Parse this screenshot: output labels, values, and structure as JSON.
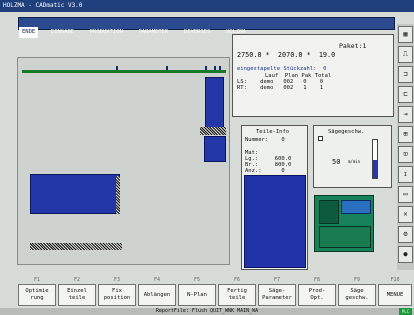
{
  "app": {
    "title": "HOLZMA - CADmatic V3.0"
  },
  "menu": {
    "items": [
      "ENDE",
      "EINGABE",
      "PRODUKTION",
      "PARAMETER",
      "DIVERSES",
      "HOLZMA"
    ]
  },
  "info": {
    "paket_line": "Paket:1",
    "dims_line": "2750.0 *  2070.0 *  19.0",
    "stueckzahl_label": "eingestapelte Stückzahl:  0",
    "header": "Lauf  Plan Pak Total",
    "ls": "LS:    demo   002   0    0",
    "rt": "RT:    demo   002   1    1"
  },
  "teile": {
    "title": "Teile-Info",
    "nummer": "Nummer:    0",
    "mat": "Mat:",
    "lg": "Lg.:     600.0",
    "br": "Br.:     800.0",
    "anz": "Anz.:      0"
  },
  "saege": {
    "title": "Sägegeschw.",
    "value": "50",
    "unit": "m/min"
  },
  "fkeys": [
    "F1",
    "F2",
    "F3",
    "F4",
    "F5",
    "F6",
    "F7",
    "F8",
    "F9",
    "F10"
  ],
  "buttons": [
    "Optimie\nrung",
    "Einzel\nteile",
    "Fix\nposition",
    "Ablängen",
    "N-Plan",
    "Fertig\nteile",
    "Säge-\nParameter",
    "Prod-\nOpt.",
    "Säge\ngeschw.",
    "MENUE"
  ],
  "status": {
    "text": "ReportFile: Flush QUIT_WNK MAIN_WA",
    "indicator": "PLC"
  },
  "colors": {
    "accent": "#2437a8",
    "rail": "#1b7a2a"
  }
}
